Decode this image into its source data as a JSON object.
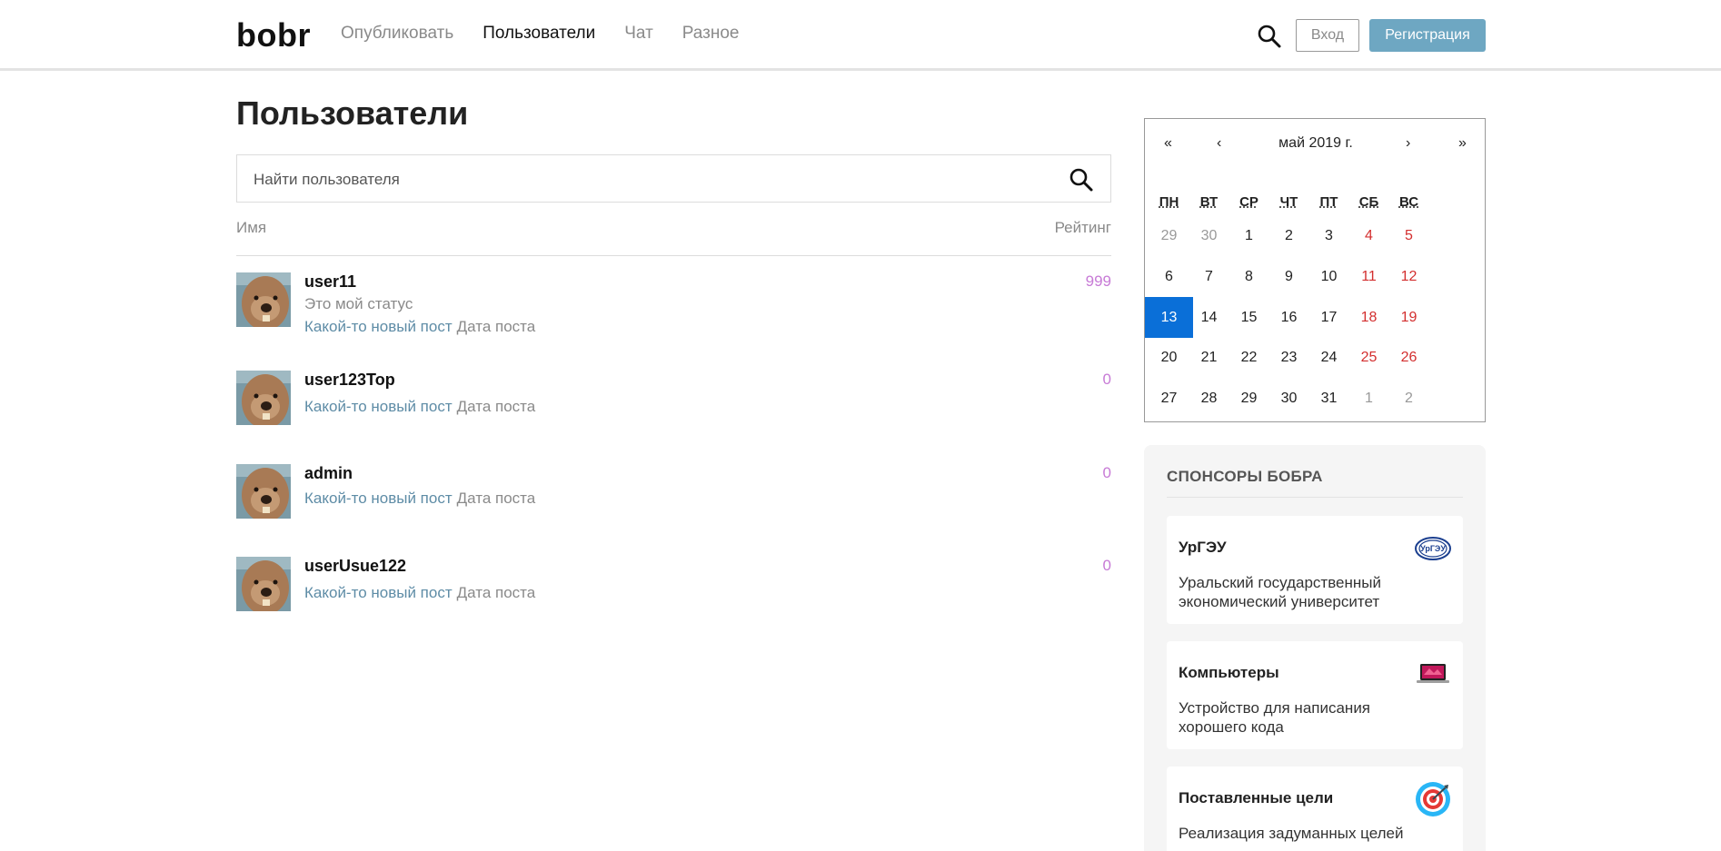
{
  "header": {
    "logo": "bobr",
    "nav": [
      "Опубликовать",
      "Пользователи",
      "Чат",
      "Разное"
    ],
    "active_nav": "Пользователи",
    "login_label": "Вход",
    "register_label": "Регистрация",
    "register_color": "#6ea7c2"
  },
  "main": {
    "title": "Пользователи",
    "search_placeholder": "Найти пользователя",
    "col_name": "Имя",
    "col_rating": "Рейтинг",
    "users": [
      {
        "name": "user11",
        "status": "Это мой статус",
        "post_title": "Какой-то новый пост",
        "post_date": "Дата поста",
        "rating": "999"
      },
      {
        "name": "user123Top",
        "status": "",
        "post_title": "Какой-то новый пост",
        "post_date": "Дата поста",
        "rating": "0"
      },
      {
        "name": "admin",
        "status": "",
        "post_title": "Какой-то новый пост",
        "post_date": "Дата поста",
        "rating": "0"
      },
      {
        "name": "userUsue122",
        "status": "",
        "post_title": "Какой-то новый пост",
        "post_date": "Дата поста",
        "rating": "0"
      }
    ]
  },
  "calendar": {
    "title": "май 2019 г.",
    "nav": {
      "prev_year": "«",
      "prev_month": "‹",
      "next_month": "›",
      "next_year": "»"
    },
    "weekdays": [
      "ПН",
      "ВТ",
      "СР",
      "ЧТ",
      "ПТ",
      "СБ",
      "ВС"
    ],
    "weeks": [
      [
        "29",
        "30",
        "1",
        "2",
        "3",
        "4",
        "5"
      ],
      [
        "6",
        "7",
        "8",
        "9",
        "10",
        "11",
        "12"
      ],
      [
        "13",
        "14",
        "15",
        "16",
        "17",
        "18",
        "19"
      ],
      [
        "20",
        "21",
        "22",
        "23",
        "24",
        "25",
        "26"
      ],
      [
        "27",
        "28",
        "29",
        "30",
        "31",
        "1",
        "2"
      ]
    ],
    "selected_day": "13",
    "today_color": "#0a6fd8",
    "weekend_color": "#d32f2f"
  },
  "sponsors": {
    "title": "СПОНСОРЫ БОБРА",
    "items": [
      {
        "name": "УрГЭУ",
        "description": "Уральский государственный экономический университет",
        "icon": "usue-logo-icon"
      },
      {
        "name": "Компьютеры",
        "description": "Устройство для написания хорошего кода",
        "icon": "laptop-icon"
      },
      {
        "name": "Поставленные цели",
        "description": "Реализация задуманных целей",
        "icon": "target-icon"
      }
    ]
  }
}
